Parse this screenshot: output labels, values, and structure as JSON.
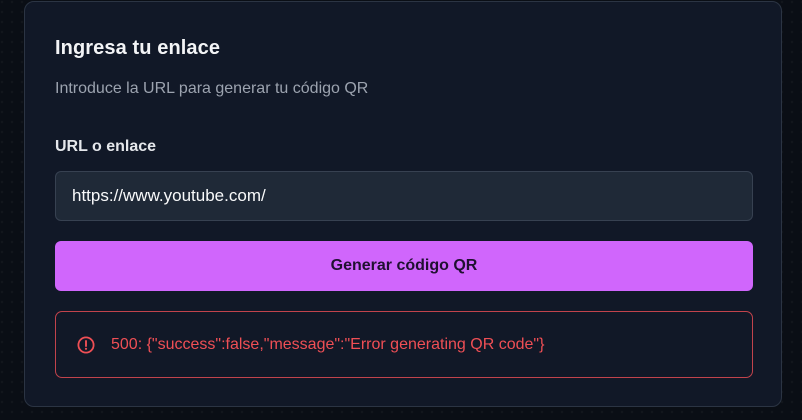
{
  "card": {
    "title": "Ingresa tu enlace",
    "subtitle": "Introduce la URL para generar tu código QR"
  },
  "form": {
    "url_label": "URL o enlace",
    "url_value": "https://www.youtube.com/",
    "submit_label": "Generar código QR"
  },
  "error": {
    "icon": "alert-circle-icon",
    "message": "500: {\"success\":false,\"message\":\"Error generating QR code\"}"
  },
  "colors": {
    "accent": "#d066fc",
    "error": "#ef4f55",
    "card_bg": "#111827"
  }
}
